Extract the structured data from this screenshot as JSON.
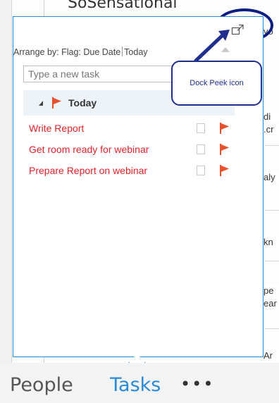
{
  "background": {
    "header_title": "SoSensational",
    "fragments": [
      "yo",
      "di",
      ".cr",
      "aly",
      "kn",
      "pe",
      "ear",
      "Ar"
    ]
  },
  "peek": {
    "arrange_label": "Arrange by: Flag: Due Date",
    "arrange_group": "Today",
    "new_task_placeholder": "Type a new task",
    "group_label": "Today",
    "tasks": [
      {
        "title": "Write Report"
      },
      {
        "title": "Get room ready for webinar"
      },
      {
        "title": "Prepare Report on webinar"
      }
    ]
  },
  "callout": {
    "text": "Dock Peek icon"
  },
  "nav": {
    "people": "People",
    "tasks": "Tasks",
    "more": "•••"
  },
  "colors": {
    "accent": "#2a8ad6",
    "task_red": "#e0232a",
    "flag_orange": "#e8512d",
    "callout_navy": "#1f2f8f"
  }
}
